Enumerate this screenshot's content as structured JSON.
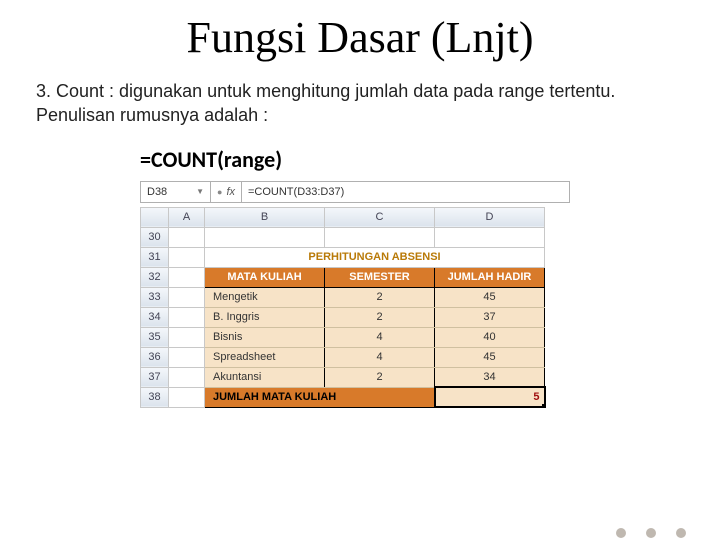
{
  "title": "Fungsi Dasar (Lnjt)",
  "body": "3. Count : digunakan untuk menghitung jumlah data pada range tertentu. Penulisan rumusnya adalah :",
  "formula_syntax": "=COUNT(range)",
  "formula_bar": {
    "cell_ref": "D38",
    "fx_label": "fx",
    "formula": "=COUNT(D33:D37)"
  },
  "columns": [
    "A",
    "B",
    "C",
    "D"
  ],
  "row_numbers": [
    "30",
    "31",
    "32",
    "33",
    "34",
    "35",
    "36",
    "37",
    "38"
  ],
  "inner_title": "PERHITUNGAN ABSENSI",
  "headers": {
    "b": "MATA KULIAH",
    "c": "SEMESTER",
    "d": "JUMLAH HADIR"
  },
  "rows": [
    {
      "mk": "Mengetik",
      "sem": "2",
      "hadir": "45"
    },
    {
      "mk": "B. Inggris",
      "sem": "2",
      "hadir": "37"
    },
    {
      "mk": "Bisnis",
      "sem": "4",
      "hadir": "40"
    },
    {
      "mk": "Spreadsheet",
      "sem": "4",
      "hadir": "45"
    },
    {
      "mk": "Akuntansi",
      "sem": "2",
      "hadir": "34"
    }
  ],
  "summary": {
    "label": "JUMLAH MATA KULIAH",
    "value": "5"
  },
  "chart_data": {
    "type": "table",
    "title": "PERHITUNGAN ABSENSI",
    "columns": [
      "MATA KULIAH",
      "SEMESTER",
      "JUMLAH HADIR"
    ],
    "rows": [
      [
        "Mengetik",
        2,
        45
      ],
      [
        "B. Inggris",
        2,
        37
      ],
      [
        "Bisnis",
        4,
        40
      ],
      [
        "Spreadsheet",
        4,
        45
      ],
      [
        "Akuntansi",
        2,
        34
      ]
    ],
    "summary": {
      "JUMLAH MATA KULIAH": 5
    },
    "formula": "=COUNT(D33:D37)"
  }
}
